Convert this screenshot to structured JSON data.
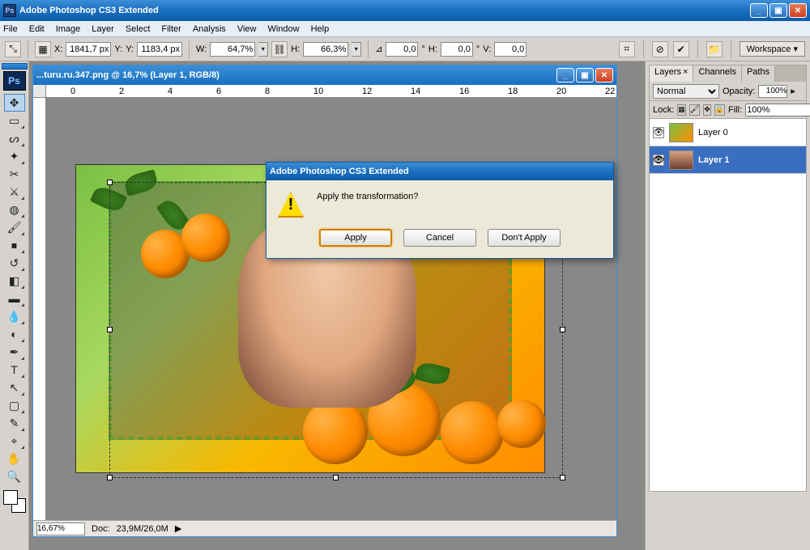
{
  "app": {
    "title": "Adobe Photoshop CS3 Extended",
    "badge": "Ps"
  },
  "window_controls": {
    "min": "_",
    "max": "▣",
    "close": "✕"
  },
  "menu": [
    "File",
    "Edit",
    "Image",
    "Layer",
    "Select",
    "Filter",
    "Analysis",
    "View",
    "Window",
    "Help"
  ],
  "options": {
    "x_label": "X:",
    "x": "1841,7 px",
    "y_label": "Y:",
    "y": "1183,4 px",
    "w_label": "W:",
    "w": "64,7%",
    "h_label": "H:",
    "h": "66,3%",
    "a_label": "⊿",
    "a": "0,0",
    "a_unit": "°",
    "hskew_label": "H:",
    "hskew": "0,0",
    "vskew_label": "V:",
    "vskew": "0,0",
    "workspace": "Workspace ▾"
  },
  "document": {
    "title": "...turu.ru.347.png @ 16,7% (Layer 1, RGB/8)",
    "zoom": "16,67%",
    "doc_size_label": "Doc:",
    "doc_size": "23,9M/26,0M"
  },
  "ruler_ticks": [
    "0",
    "2",
    "4",
    "6",
    "8",
    "10",
    "12",
    "14",
    "16",
    "18",
    "20",
    "22"
  ],
  "dialog": {
    "title": "Adobe Photoshop CS3 Extended",
    "message": "Apply the transformation?",
    "apply": "Apply",
    "cancel": "Cancel",
    "dont_apply": "Don't Apply"
  },
  "panels": {
    "tabs": [
      "Layers",
      "Channels",
      "Paths"
    ],
    "blend_mode": "Normal",
    "opacity_label": "Opacity:",
    "opacity": "100%",
    "lock_label": "Lock:",
    "fill_label": "Fill:",
    "fill": "100%",
    "layers": [
      {
        "name": "Layer 0",
        "selected": false
      },
      {
        "name": "Layer 1",
        "selected": true
      }
    ]
  },
  "tools": [
    "move",
    "marquee",
    "lasso",
    "wand",
    "crop",
    "slice",
    "heal",
    "brush",
    "stamp",
    "history",
    "eraser",
    "gradient",
    "blur",
    "dodge",
    "pen",
    "type",
    "path",
    "rect",
    "notes",
    "eyedrop",
    "hand",
    "zoom"
  ]
}
